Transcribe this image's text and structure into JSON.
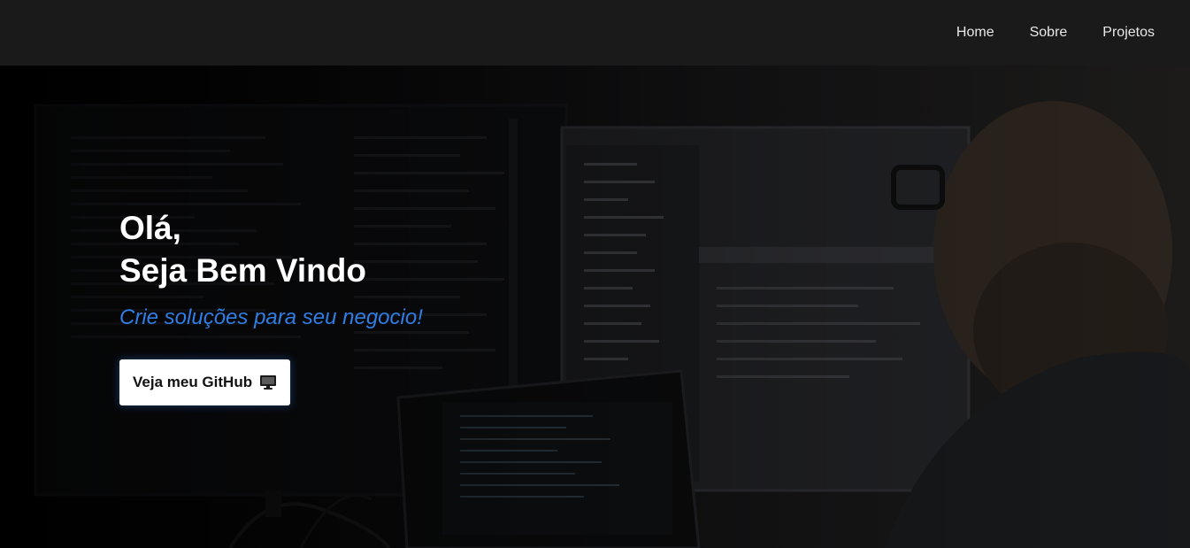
{
  "nav": {
    "items": [
      {
        "label": "Home"
      },
      {
        "label": "Sobre"
      },
      {
        "label": "Projetos"
      }
    ]
  },
  "hero": {
    "title_line1": "Olá,",
    "title_line2": "Seja Bem Vindo",
    "subtitle": "Crie soluções para seu negocio!",
    "button_label": "Veja meu GitHub",
    "button_icon": "desktop-monitor-icon",
    "accent_color": "#2f7ee6"
  }
}
